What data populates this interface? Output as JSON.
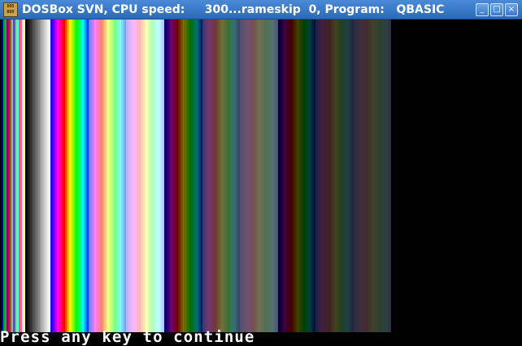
{
  "window": {
    "title": "DOSBox SVN, CPU speed:     300...rameskip  0, Program:   QBASIC",
    "icon_text": "DOS BOX",
    "icon": "dosbox-app-icon",
    "controls": {
      "minimize": "_",
      "maximize": "□",
      "close": "×"
    }
  },
  "screen": {
    "prompt": "Press any key to continue"
  }
}
